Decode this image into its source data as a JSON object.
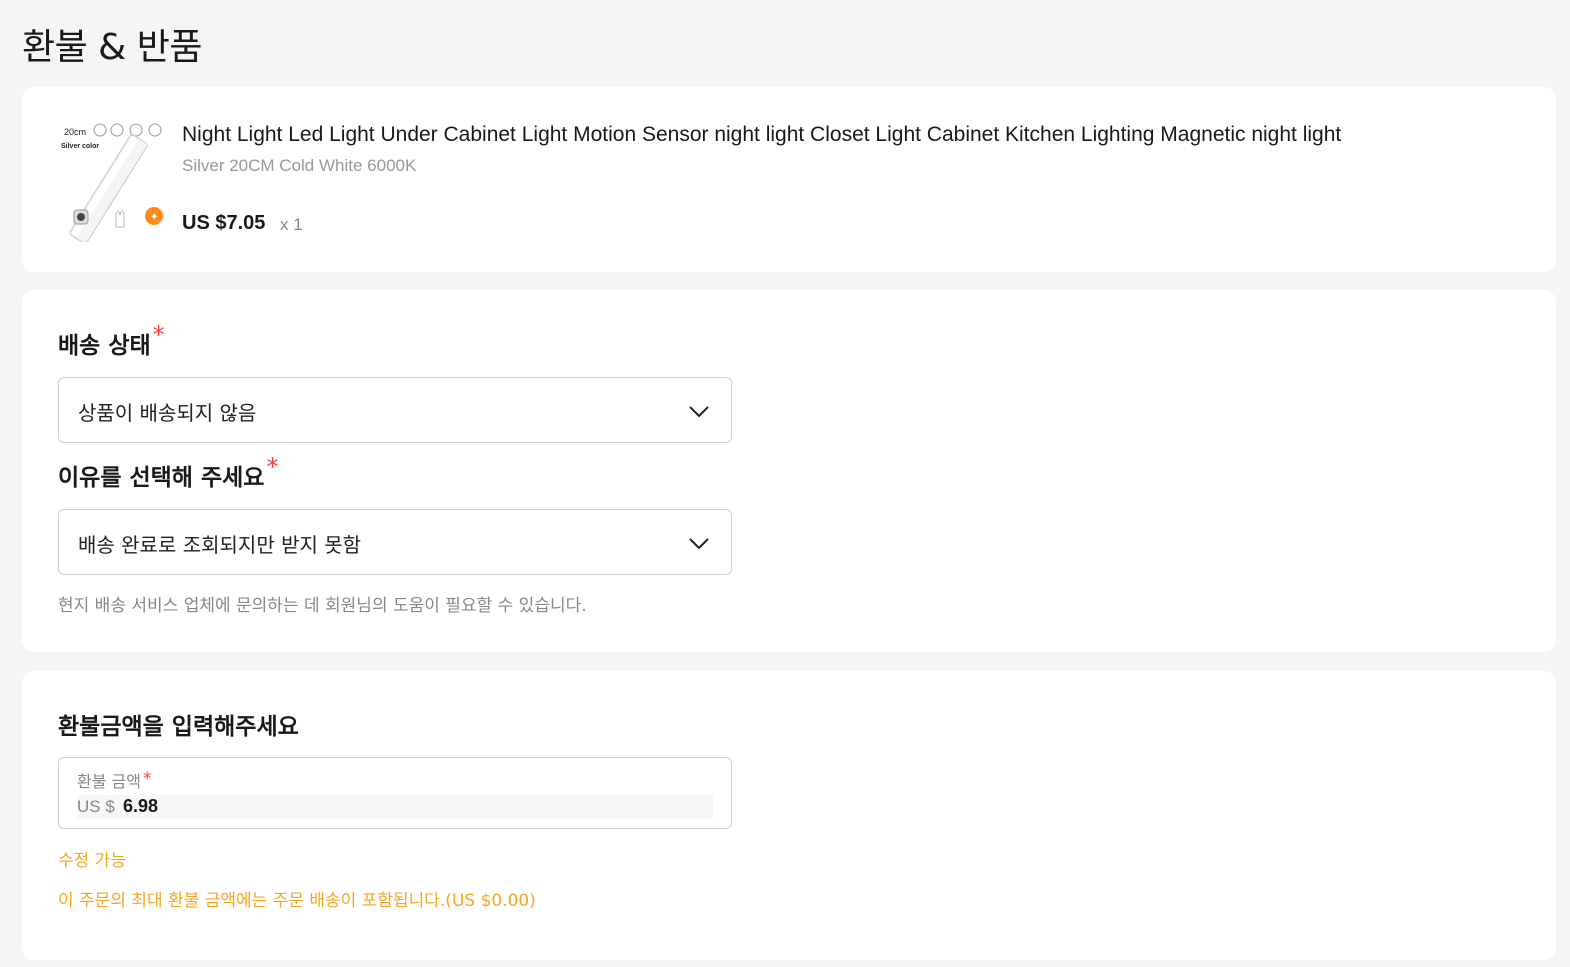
{
  "page": {
    "title": "환불 & 반품"
  },
  "product": {
    "title": "Night Light Led Light Under Cabinet Light Motion Sensor night light Closet Light Cabinet Kitchen Lighting Magnetic night light",
    "sku": "Silver 20CM Cold White 6000K",
    "price": "US $7.05",
    "quantity": "x 1",
    "thumbnail_text": {
      "size": "20cm",
      "color": "Silver color"
    }
  },
  "shipping": {
    "status_label": "배송 상태",
    "status_value": "상품이 배송되지 않음",
    "reason_label": "이유를 선택해 주세요",
    "reason_value": "배송 완료로 조회되지만 받지 못함",
    "hint": "현지 배송 서비스 업체에 문의하는 데 회원님의 도움이 필요할 수 있습니다."
  },
  "refund": {
    "heading": "환불금액을 입력해주세요",
    "field_label": "환불 금액",
    "currency": "US $",
    "amount": "6.98",
    "editable_note": "수정 가능",
    "max_note": "이 주문의 최대 환불 금액에는 주문 배송이 포함됩니다.(US $0.00)"
  },
  "required_marker": "*",
  "colors": {
    "required": "#ff3b30",
    "warning": "#f5a623",
    "accent": "#ff7a00"
  }
}
